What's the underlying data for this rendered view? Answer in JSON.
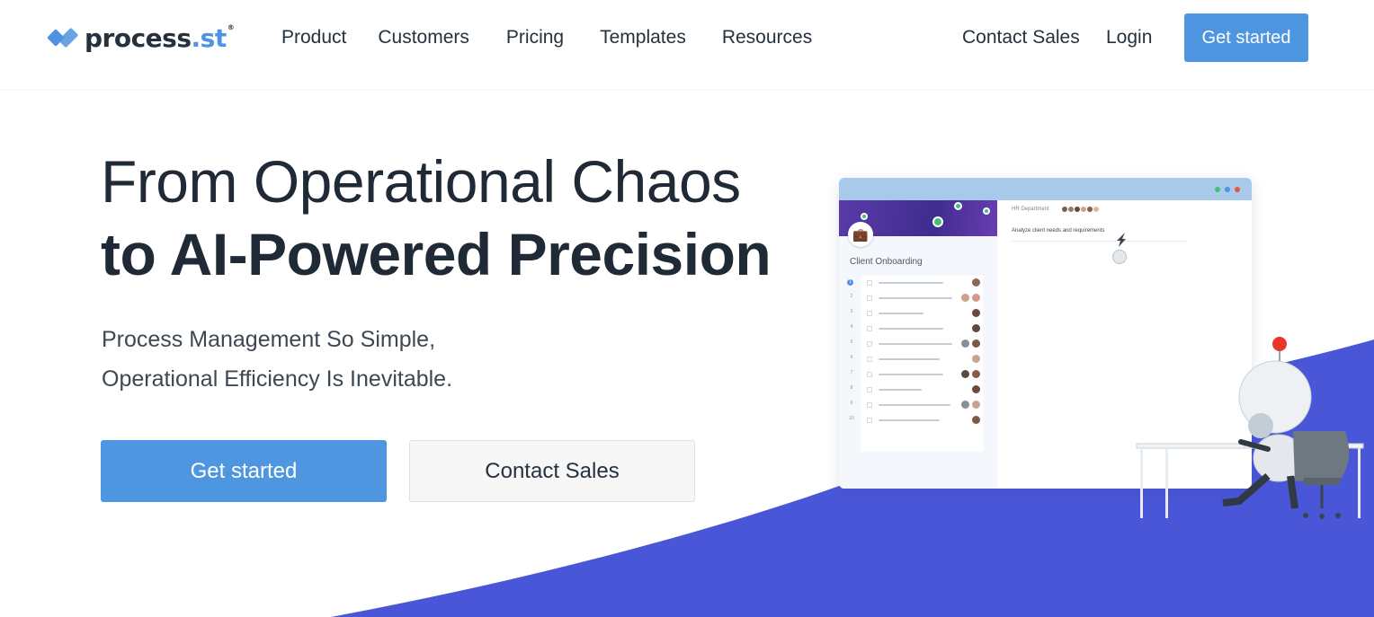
{
  "header": {
    "logo_text_main": "process",
    "logo_text_dot": ".st",
    "logo_registered": "®",
    "nav": [
      {
        "label": "Product"
      },
      {
        "label": "Customers"
      },
      {
        "label": "Pricing"
      },
      {
        "label": "Templates"
      },
      {
        "label": "Resources"
      }
    ],
    "contact_sales": "Contact Sales",
    "login": "Login",
    "get_started": "Get started"
  },
  "hero": {
    "title_line1": "From Operational Chaos",
    "title_line2": "to AI-Powered Precision",
    "subtitle_line1": "Process Management So Simple,",
    "subtitle_line2": "Operational Efficiency Is Inevitable.",
    "primary_cta": "Get started",
    "secondary_cta": "Contact Sales"
  },
  "illustration": {
    "checklist_title": "Client Onboarding",
    "department_label": "HR Department",
    "task_heading": "Analyze client needs and requirements",
    "task_numbers": [
      "1",
      "2",
      "3",
      "4",
      "5",
      "6",
      "7",
      "8",
      "9",
      "10"
    ]
  },
  "colors": {
    "accent": "#4f96e0",
    "wave": "#4a56d8",
    "text_dark": "#1f2a36"
  }
}
